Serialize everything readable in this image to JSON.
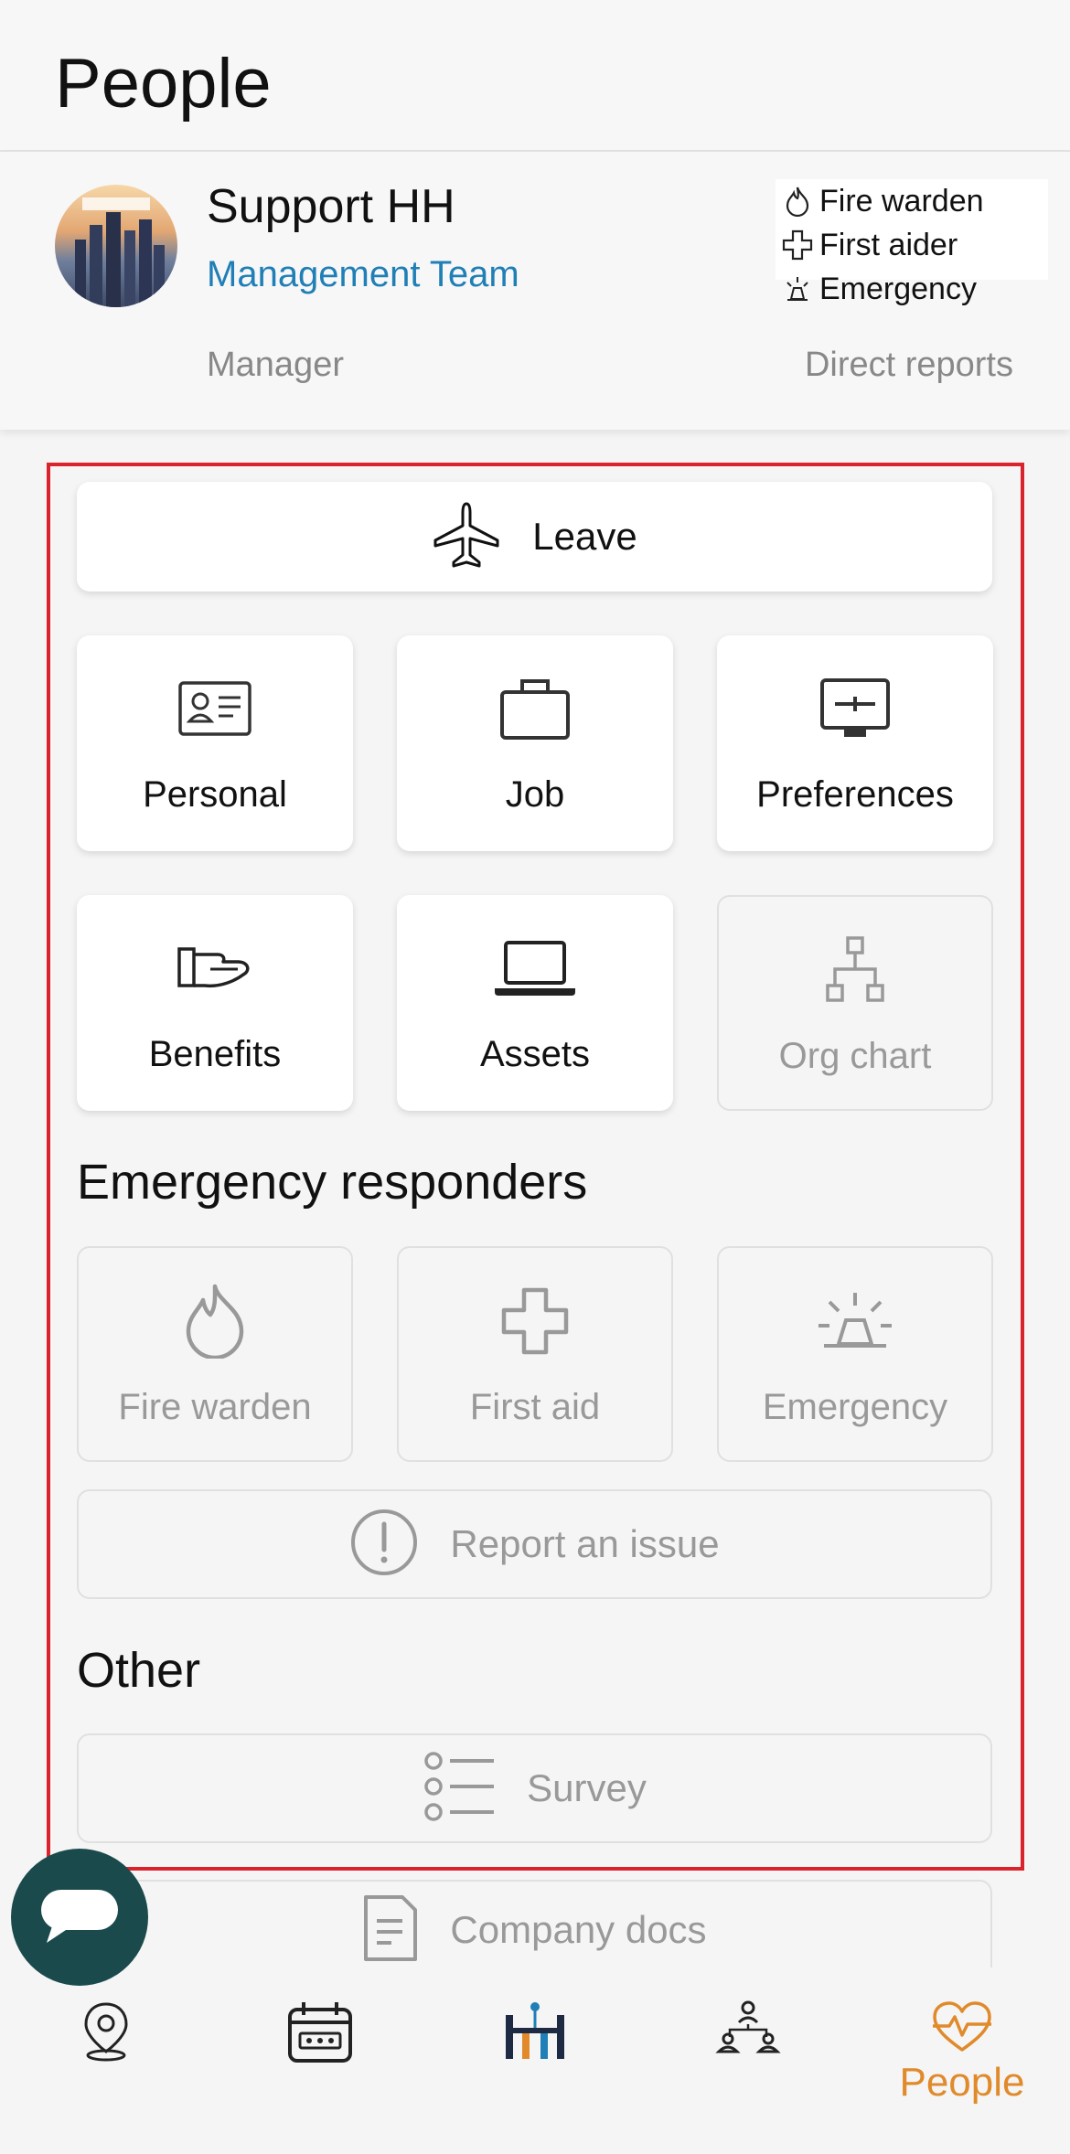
{
  "header": {
    "title": "People"
  },
  "profile": {
    "name": "Support HH",
    "team": "Management Team",
    "manager_label": "Manager",
    "reports_label": "Direct reports",
    "roles": [
      {
        "label": "Fire warden",
        "icon": "flame-icon"
      },
      {
        "label": "First aider",
        "icon": "cross-icon"
      },
      {
        "label": "Emergency",
        "icon": "siren-icon"
      }
    ]
  },
  "leave": {
    "label": "Leave",
    "icon": "airplane-icon"
  },
  "tiles": [
    {
      "label": "Personal",
      "icon": "id-card-icon",
      "enabled": true
    },
    {
      "label": "Job",
      "icon": "briefcase-icon",
      "enabled": true
    },
    {
      "label": "Preferences",
      "icon": "monitor-icon",
      "enabled": true
    },
    {
      "label": "Benefits",
      "icon": "hand-icon",
      "enabled": true
    },
    {
      "label": "Assets",
      "icon": "laptop-icon",
      "enabled": true
    },
    {
      "label": "Org chart",
      "icon": "org-chart-icon",
      "enabled": false
    }
  ],
  "emergency": {
    "title": "Emergency responders",
    "tiles": [
      {
        "label": "Fire warden",
        "icon": "flame-icon"
      },
      {
        "label": "First aid",
        "icon": "cross-icon"
      },
      {
        "label": "Emergency",
        "icon": "siren-icon"
      }
    ],
    "report": {
      "label": "Report an issue",
      "icon": "exclamation-icon"
    }
  },
  "other": {
    "title": "Other",
    "survey": {
      "label": "Survey",
      "icon": "list-icon"
    },
    "docs": {
      "label": "Company docs",
      "icon": "document-icon"
    }
  },
  "bottom_nav": {
    "items": [
      {
        "icon": "location-pin-icon",
        "label": ""
      },
      {
        "icon": "calendar-icon",
        "label": ""
      },
      {
        "icon": "hh-logo-icon",
        "label": ""
      },
      {
        "icon": "team-icon",
        "label": ""
      },
      {
        "icon": "heart-pulse-icon",
        "label": "People",
        "active": true
      }
    ]
  },
  "colors": {
    "accent_blue": "#1f7fb6",
    "active_orange": "#e08a2b",
    "highlight_red": "#d9232d",
    "fab_teal": "#1a4a4c"
  }
}
